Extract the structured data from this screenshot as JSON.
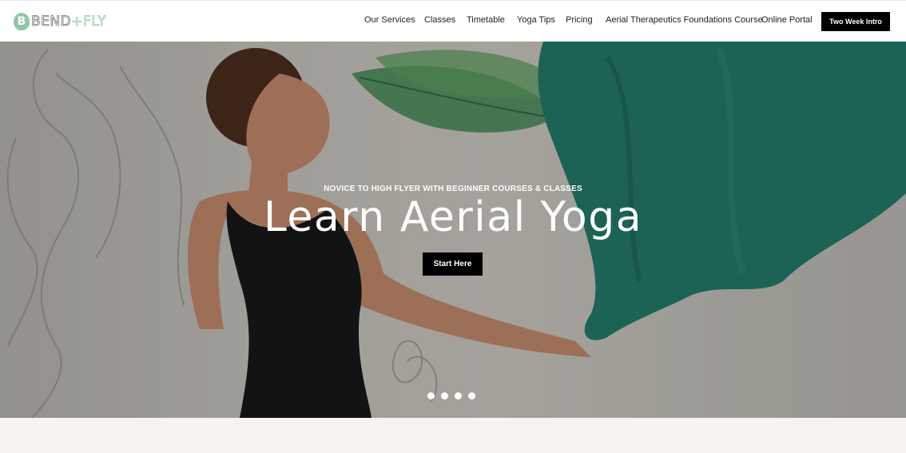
{
  "header": {
    "logo": {
      "mark": "B",
      "brand_left": "BEND",
      "brand_plus": "+",
      "brand_right": "FLY"
    },
    "nav": [
      {
        "label": "Our Services"
      },
      {
        "label": "Classes"
      },
      {
        "label": "Timetable"
      },
      {
        "label": "Yoga Tips"
      },
      {
        "label": "Pricing"
      },
      {
        "label": "Aerial Therapeutics Foundations Course"
      },
      {
        "label": "Online Portal"
      }
    ],
    "cta_label": "Two Week Intro"
  },
  "hero": {
    "eyebrow": "NOVICE TO HIGH FLYER WITH BEGINNER COURSES & CLASSES",
    "title": "Learn Aerial Yoga",
    "button_label": "Start Here",
    "slides": 4,
    "colors": {
      "silk": "#1f7a68",
      "leaf": "#3f8a52",
      "tank_top": "#141414"
    }
  }
}
